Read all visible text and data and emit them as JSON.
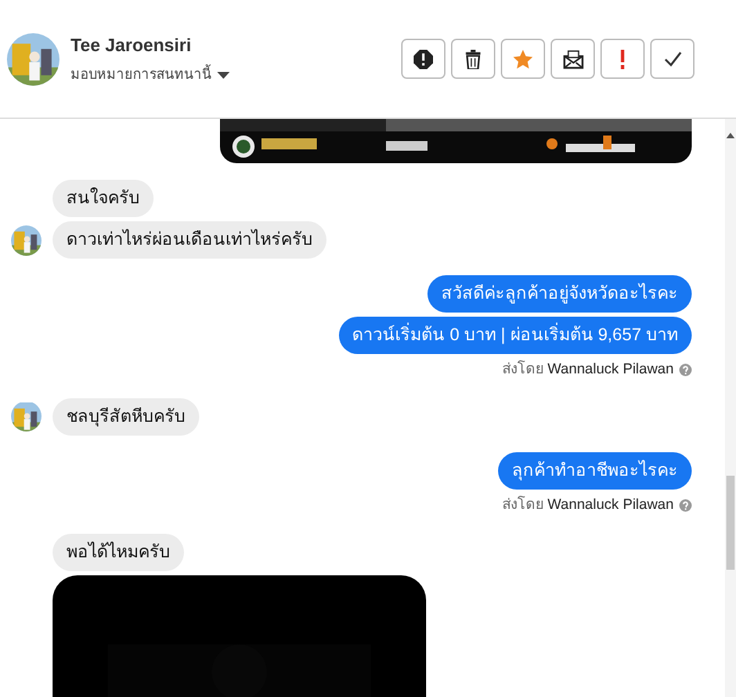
{
  "header": {
    "name": "Tee Jaroensiri",
    "assign_label": "มอบหมายการสนทนานี้",
    "actions": [
      {
        "kind": "alert"
      },
      {
        "kind": "trash"
      },
      {
        "kind": "star",
        "on": true
      },
      {
        "kind": "mail"
      },
      {
        "kind": "important"
      },
      {
        "kind": "check"
      }
    ]
  },
  "messages": [
    {
      "kind": "banner",
      "outgoing": true
    },
    {
      "kind": "text",
      "outgoing": false,
      "text": "สนใจครับ",
      "avatar": false
    },
    {
      "kind": "text",
      "outgoing": false,
      "text": "ดาวเท่าไหร่ผ่อนเดือนเท่าไหร่ครับ",
      "avatar": true
    },
    {
      "kind": "text",
      "outgoing": true,
      "text": "สวัสดีค่ะลูกค้าอยู่จังหวัดอะไรคะ"
    },
    {
      "kind": "text",
      "outgoing": true,
      "text": "ดาวน์เริ่มต้น 0 บาท | ผ่อนเริ่มต้น  9,657 บาท"
    },
    {
      "kind": "sent_by",
      "prefix": "ส่งโดย",
      "agent": "Wannaluck Pilawan"
    },
    {
      "kind": "text",
      "outgoing": false,
      "text": "ชลบุรีสัตหีบครับ",
      "avatar": true
    },
    {
      "kind": "text",
      "outgoing": true,
      "text": "ลุกค้าทำอาชีพอะไรคะ"
    },
    {
      "kind": "sent_by",
      "prefix": "ส่งโดย",
      "agent": "Wannaluck Pilawan"
    },
    {
      "kind": "text",
      "outgoing": false,
      "text": "พอได้ไหมครับ",
      "avatar": false
    },
    {
      "kind": "video",
      "outgoing": false
    }
  ]
}
